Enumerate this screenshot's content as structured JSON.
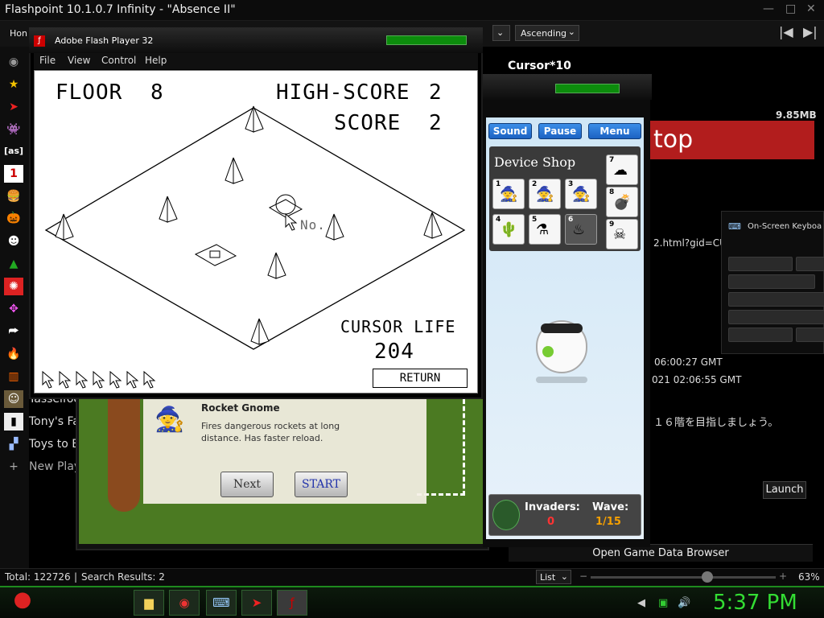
{
  "app": {
    "title": "Flashpoint 10.1.0.7 Infinity - \"Absence II\"",
    "nav_home": "Hon",
    "sort_order": "Ascending",
    "window_controls": [
      "—",
      "□",
      "✕"
    ]
  },
  "sidebar": {
    "items": [
      {
        "icon": "eye-icon",
        "label": ""
      },
      {
        "icon": "star-icon",
        "label": ""
      },
      {
        "icon": "flash-arrow-icon",
        "label": ""
      },
      {
        "icon": "space-invader-icon",
        "label": ""
      },
      {
        "icon": "as-icon",
        "label": "[as]"
      },
      {
        "icon": "one-icon",
        "label": "1"
      },
      {
        "icon": "burger-icon",
        "label": ""
      },
      {
        "icon": "pumpkin-icon",
        "label": ""
      },
      {
        "icon": "face-icon",
        "label": ""
      },
      {
        "icon": "tree-icon",
        "label": ""
      },
      {
        "icon": "badge-icon",
        "label": ""
      },
      {
        "icon": "pixel-icon",
        "label": ""
      },
      {
        "icon": "share-icon",
        "label": ""
      },
      {
        "icon": "fire-icon",
        "label": ""
      },
      {
        "icon": "audio-icon",
        "label": ""
      }
    ],
    "playlists": [
      {
        "icon": "avatar-icon",
        "label": "Tasselfoo"
      },
      {
        "icon": "person-icon",
        "label": "Tony's Fa"
      },
      {
        "icon": "blocks-icon",
        "label": "Toys to E"
      },
      {
        "icon": "plus-icon",
        "label": "New Play"
      }
    ]
  },
  "flash_player": {
    "title": "Adobe Flash Player 32",
    "menu": [
      "File",
      "View",
      "Control",
      "Help"
    ]
  },
  "game": {
    "floor_label": "FLOOR",
    "floor_value": "8",
    "highscore_label": "HIGH-SCORE",
    "highscore_value": "2",
    "score_label": "SCORE",
    "score_value": "2",
    "cursor_life_label": "CURSOR LIFE",
    "cursor_life_value": "204",
    "return_label": "RETURN",
    "no_label": "No.",
    "remaining_cursors": 7
  },
  "bg_game": {
    "window_label": "Cursor*10",
    "buttons": [
      "Sound",
      "Pause",
      "Menu"
    ],
    "shop_title": "Device Shop",
    "shop_items": [
      "1",
      "2",
      "3",
      "4",
      "5",
      "6",
      "7",
      "8",
      "9"
    ],
    "invaders_label": "Invaders:",
    "invaders_value": "0",
    "wave_label": "Wave:",
    "wave_value": "1/15",
    "tooltip_title": "Rocket Gnome",
    "tooltip_desc": "Fires dangerous rockets at long distance. Has faster reload.",
    "next_label": "Next",
    "start_label": "START"
  },
  "details": {
    "file_size": "9.85MB",
    "banner_text": "top",
    "url_fragment": "2.html?gid=CU",
    "date1": "06:00:27 GMT",
    "date2": "021 02:06:55 GMT",
    "notes": "１６階を目指しましょう。",
    "launch_label": "Launch",
    "open_data_browser": "Open Game Data Browser"
  },
  "osk": {
    "title": "On-Screen Keyboa"
  },
  "status_bar": {
    "total": "Total: 122726",
    "search_results": "Search Results: 2",
    "view_mode": "List",
    "zoom": "63%",
    "zoom_fraction": 0.63
  },
  "taskbar": {
    "clock": "5:37 PM",
    "apps": [
      "folder-icon",
      "chrome-icon",
      "keyboard-icon",
      "flashpoint-icon",
      "flash-player-icon"
    ]
  },
  "colors": {
    "accent_green": "#1e8a1e",
    "banner_red": "#b21d1d",
    "clock_green": "#33dd33"
  }
}
